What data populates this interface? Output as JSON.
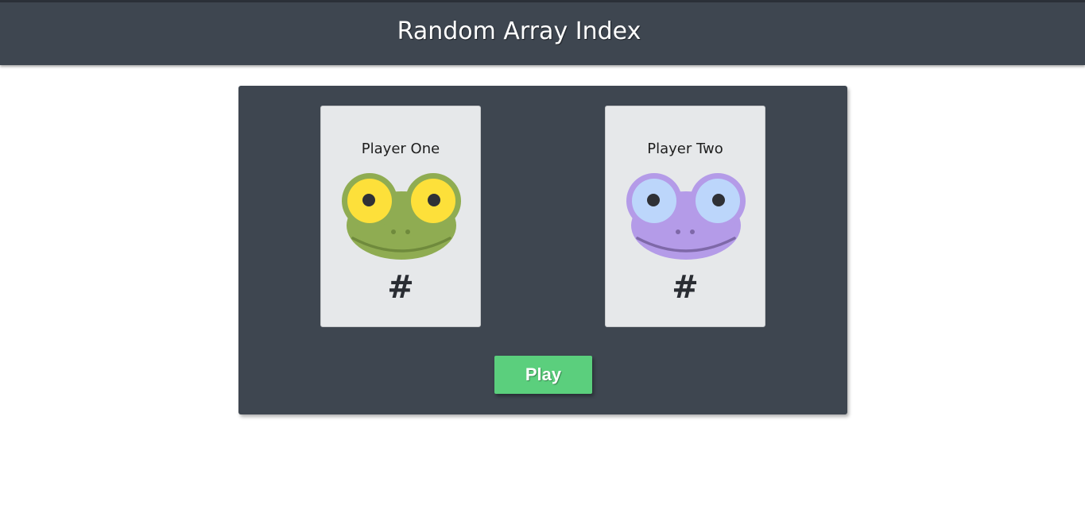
{
  "header": {
    "title": "Random Array Index"
  },
  "players": [
    {
      "name": "Player One",
      "number": "#",
      "avatar": "frog-icon",
      "colors": {
        "face": "#8fac52",
        "eye": "#fde03a",
        "mouth": "#6f8a3c"
      }
    },
    {
      "name": "Player Two",
      "number": "#",
      "avatar": "frog-icon",
      "colors": {
        "face": "#b49be8",
        "eye": "#bcd6fb",
        "mouth": "#7e68a8"
      }
    }
  ],
  "controls": {
    "play_label": "Play"
  },
  "colors": {
    "header_bg": "#3e4650",
    "panel_bg": "#3e4650",
    "card_bg": "#e6e8ea",
    "play_button": "#5bcf7d"
  }
}
